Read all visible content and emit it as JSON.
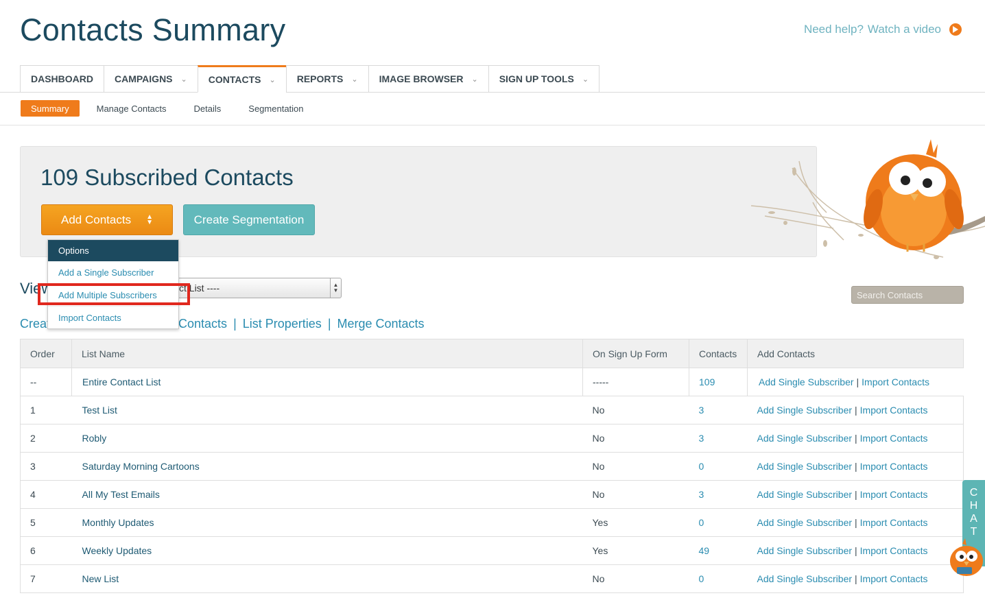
{
  "header": {
    "title": "Contacts Summary",
    "help_text": "Need help?",
    "video_text": "Watch a video"
  },
  "main_tabs": [
    {
      "label": "DASHBOARD",
      "dropdown": false,
      "active": false
    },
    {
      "label": "CAMPAIGNS",
      "dropdown": true,
      "active": false
    },
    {
      "label": "CONTACTS",
      "dropdown": true,
      "active": true
    },
    {
      "label": "REPORTS",
      "dropdown": true,
      "active": false
    },
    {
      "label": "IMAGE BROWSER",
      "dropdown": true,
      "active": false
    },
    {
      "label": "SIGN UP TOOLS",
      "dropdown": true,
      "active": false
    }
  ],
  "sub_tabs": [
    {
      "label": "Summary",
      "active": true
    },
    {
      "label": "Manage Contacts",
      "active": false
    },
    {
      "label": "Details",
      "active": false
    },
    {
      "label": "Segmentation",
      "active": false
    }
  ],
  "summary": {
    "subscribed_text": "109 Subscribed Contacts",
    "add_contacts_label": "Add Contacts",
    "create_segmentation_label": "Create Segmentation"
  },
  "dropdown": {
    "header": "Options",
    "options": [
      "Add a Single Subscriber",
      "Add Multiple Subscribers",
      "Import Contacts"
    ],
    "highlighted": "Add Multiple Subscribers"
  },
  "view": {
    "label": "View",
    "select_value": "ct List ----",
    "search_placeholder": "Search Contacts"
  },
  "links": {
    "create_fragment": "Creat",
    "contacts_fragment": "e Contacts",
    "list_properties": "List Properties",
    "merge_contacts": "Merge Contacts",
    "separator": "|"
  },
  "table": {
    "headers": [
      "Order",
      "List Name",
      "On Sign Up Form",
      "Contacts",
      "Add Contacts"
    ],
    "action_single": "Add Single Subscriber",
    "action_import": "Import Contacts",
    "action_separator": "|",
    "rows": [
      {
        "order": "--",
        "name": "Entire Contact List",
        "signup": "-----",
        "contacts": "109"
      },
      {
        "order": "1",
        "name": "Test List",
        "signup": "No",
        "contacts": "3"
      },
      {
        "order": "2",
        "name": "Robly",
        "signup": "No",
        "contacts": "3"
      },
      {
        "order": "3",
        "name": "Saturday Morning Cartoons",
        "signup": "No",
        "contacts": "0"
      },
      {
        "order": "4",
        "name": "All My Test Emails",
        "signup": "No",
        "contacts": "3"
      },
      {
        "order": "5",
        "name": "Monthly Updates",
        "signup": "Yes",
        "contacts": "0"
      },
      {
        "order": "6",
        "name": "Weekly Updates",
        "signup": "Yes",
        "contacts": "49"
      },
      {
        "order": "7",
        "name": "New List",
        "signup": "No",
        "contacts": "0"
      }
    ]
  },
  "chat": {
    "letters": [
      "C",
      "H",
      "A",
      "T"
    ]
  },
  "colors": {
    "accent_orange": "#ef7b1b",
    "teal": "#62b9bb",
    "navy": "#1c4a5f",
    "link_blue": "#2a8cb0",
    "highlight_red": "#e0281e"
  },
  "icons": {
    "play": "play-circle-icon",
    "chevron": "chevron-down-icon",
    "updown": "updown-arrows-icon",
    "mascot": "bird-mascot"
  }
}
